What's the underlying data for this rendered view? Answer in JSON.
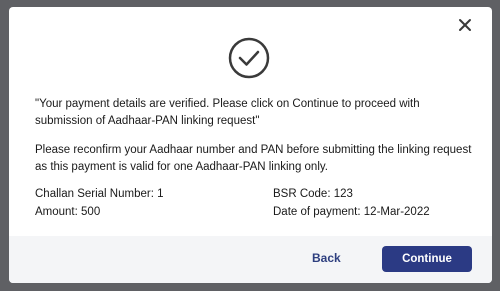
{
  "dialog": {
    "primary_message": "\"Your payment details are verified. Please click on Continue to proceed with submission of Aadhaar-PAN linking request\"",
    "secondary_message": "Please reconfirm your Aadhaar number and PAN before submitting the linking request as this payment is valid for one Aadhaar-PAN linking only.",
    "details": {
      "challan_label": "Challan Serial Number:",
      "challan_value": "1",
      "amount_label": "Amount:",
      "amount_value": "500",
      "bsr_label": "BSR Code:",
      "bsr_value": "123",
      "date_label": "Date of payment:",
      "date_value": "12-Mar-2022"
    },
    "buttons": {
      "back_label": "Back",
      "continue_label": "Continue"
    },
    "icons": {
      "close": "close-icon",
      "success": "check-circle-icon"
    },
    "colors": {
      "primary": "#2b3a84",
      "link": "#2e3f7f",
      "footer_bg": "#f4f5f7"
    }
  }
}
